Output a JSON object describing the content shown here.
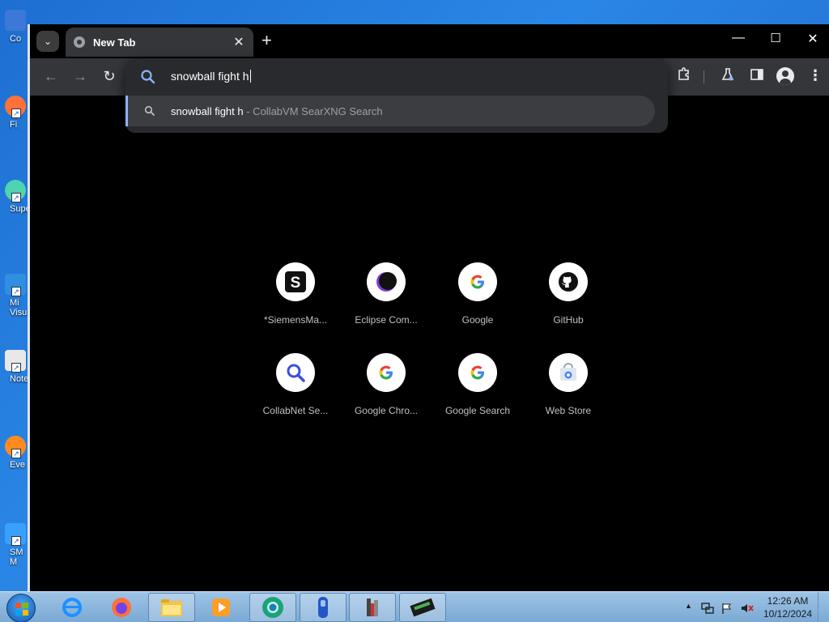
{
  "desktop": {
    "icons": [
      {
        "label": "Co",
        "color": "#3b78d8"
      },
      {
        "label": "Fi",
        "color": "#ff7139"
      },
      {
        "label": "Supe",
        "color": "#4fd3b0"
      },
      {
        "label": "Mi\nVisua",
        "color": "#2f8fe0"
      },
      {
        "label": "Note",
        "color": "#e8e8e8"
      },
      {
        "label": "Eve",
        "color": "#ff8a1f"
      },
      {
        "label": "SM\nM",
        "color": "#3aa0ff"
      }
    ]
  },
  "browser": {
    "tab_title": "New Tab",
    "tab_close": "✕",
    "new_tab": "+",
    "window_controls": {
      "minimize": "—",
      "maximize": "☐",
      "close": "✕"
    },
    "nav": {
      "back": "←",
      "forward": "→",
      "reload": "↻"
    },
    "toolbar_icons": [
      "puzzle-icon",
      "labs-flask-icon",
      "side-panel-icon",
      "profile-icon",
      "kebab-menu-icon"
    ],
    "omnibox": {
      "query": "snowball fight h",
      "suggestion": {
        "query": "snowball fight h",
        "suffix": " - CollabVM SearXNG Search"
      }
    },
    "shortcuts": [
      {
        "name": "*SiemensMa...",
        "icon": "siemens-s-icon"
      },
      {
        "name": "Eclipse Com...",
        "icon": "eclipse-icon"
      },
      {
        "name": "Google",
        "icon": "google-g-icon"
      },
      {
        "name": "GitHub",
        "icon": "github-icon"
      },
      {
        "name": "CollabNet Se...",
        "icon": "search-magnifier-icon"
      },
      {
        "name": "Google Chro...",
        "icon": "google-g-icon"
      },
      {
        "name": "Google Search",
        "icon": "google-g-icon"
      },
      {
        "name": "Web Store",
        "icon": "web-store-icon"
      }
    ]
  },
  "taskbar": {
    "items": [
      "internet-explorer-icon",
      "firefox-icon",
      "file-explorer-icon",
      "media-player-icon",
      "chrome-icon",
      "remote-device-icon",
      "tools-icon",
      "memory-card-icon"
    ],
    "clock_time": "12:26 AM",
    "clock_date": "10/12/2024",
    "tray_chevron": "▲"
  },
  "colors": {
    "accent": "#8ab4f8",
    "toolbar": "#35363a",
    "omnibox_bg": "#282a2d",
    "desktop": "#1d6fd1"
  }
}
